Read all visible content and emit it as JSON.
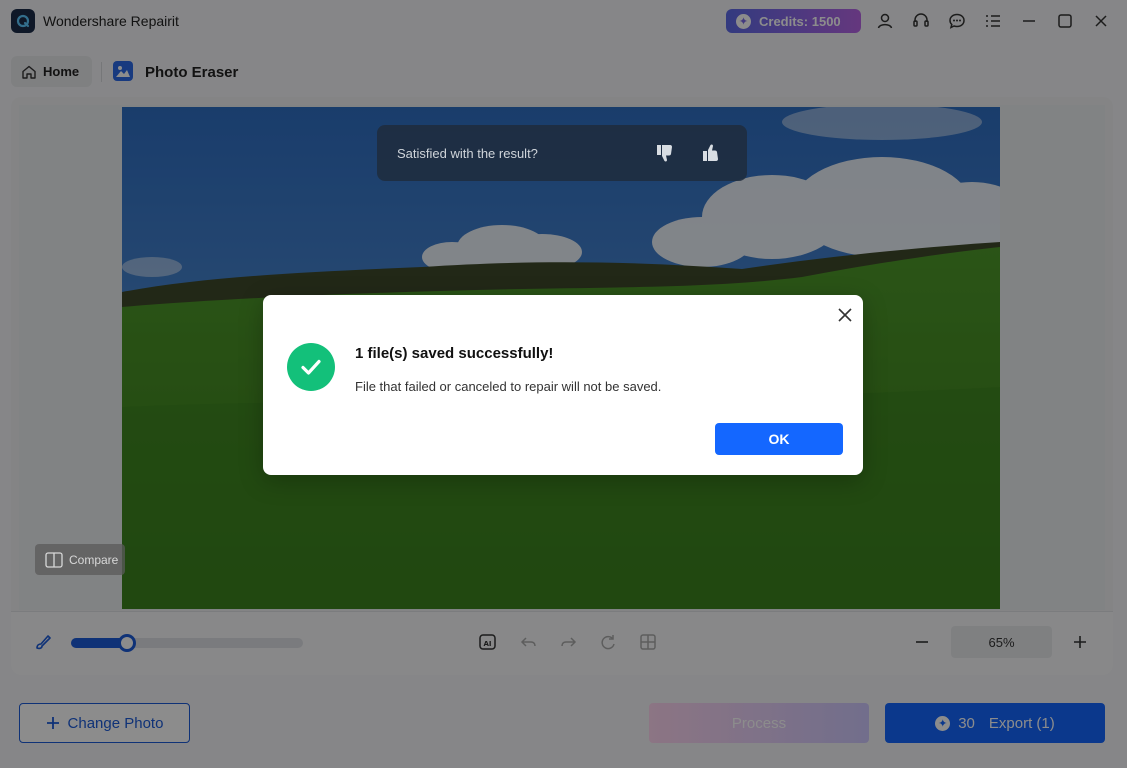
{
  "app": {
    "title": "Wondershare Repairit"
  },
  "credits": {
    "label": "Credits: 1500"
  },
  "nav": {
    "home_label": "Home",
    "tool_title": "Photo Eraser"
  },
  "feedback": {
    "question": "Satisfied with the result?"
  },
  "compare": {
    "label": "Compare"
  },
  "brush": {
    "size_fraction": 0.24
  },
  "zoom": {
    "value": "65%"
  },
  "buttons": {
    "change_photo": "Change Photo",
    "process": "Process",
    "export_cost": "30",
    "export_label": "Export (1)"
  },
  "dialog": {
    "title": "1 file(s) saved successfully!",
    "message": "File that failed or canceled to repair will not be saved.",
    "ok_label": "OK"
  },
  "colors": {
    "accent": "#1467ff",
    "success": "#13c07a",
    "credits_gradient_start": "#5d6be8",
    "credits_gradient_end": "#b865e6"
  }
}
